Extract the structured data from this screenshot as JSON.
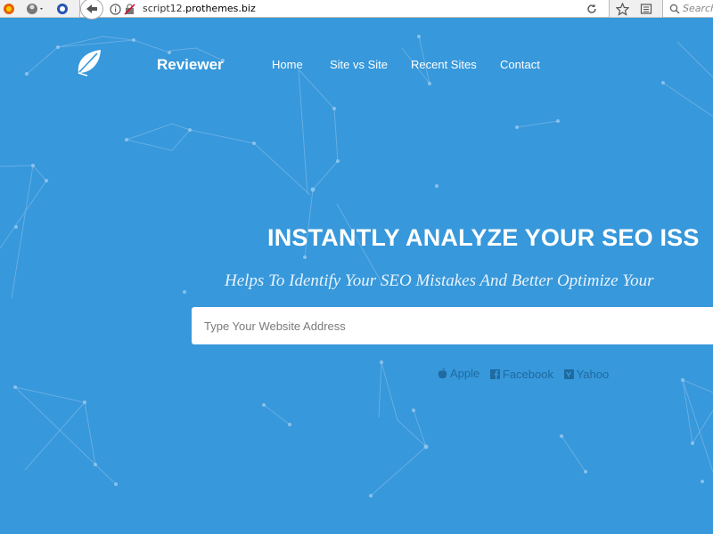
{
  "browser": {
    "url_prefix": "script12.",
    "url_host": "prothemes.biz",
    "search_placeholder": "Search"
  },
  "site": {
    "brand": "Reviewer",
    "nav": [
      "Home",
      "Site vs Site",
      "Recent Sites",
      "Contact"
    ],
    "headline": "INSTANTLY ANALYZE YOUR SEO ISS",
    "subline": "Helps To Identify Your SEO Mistakes And Better Optimize Your",
    "input_placeholder": "Type Your Website Address",
    "examples": [
      "Apple",
      "Facebook",
      "Yahoo"
    ]
  },
  "colors": {
    "hero_bg": "#3798db",
    "example_link": "#1f6aa0"
  }
}
